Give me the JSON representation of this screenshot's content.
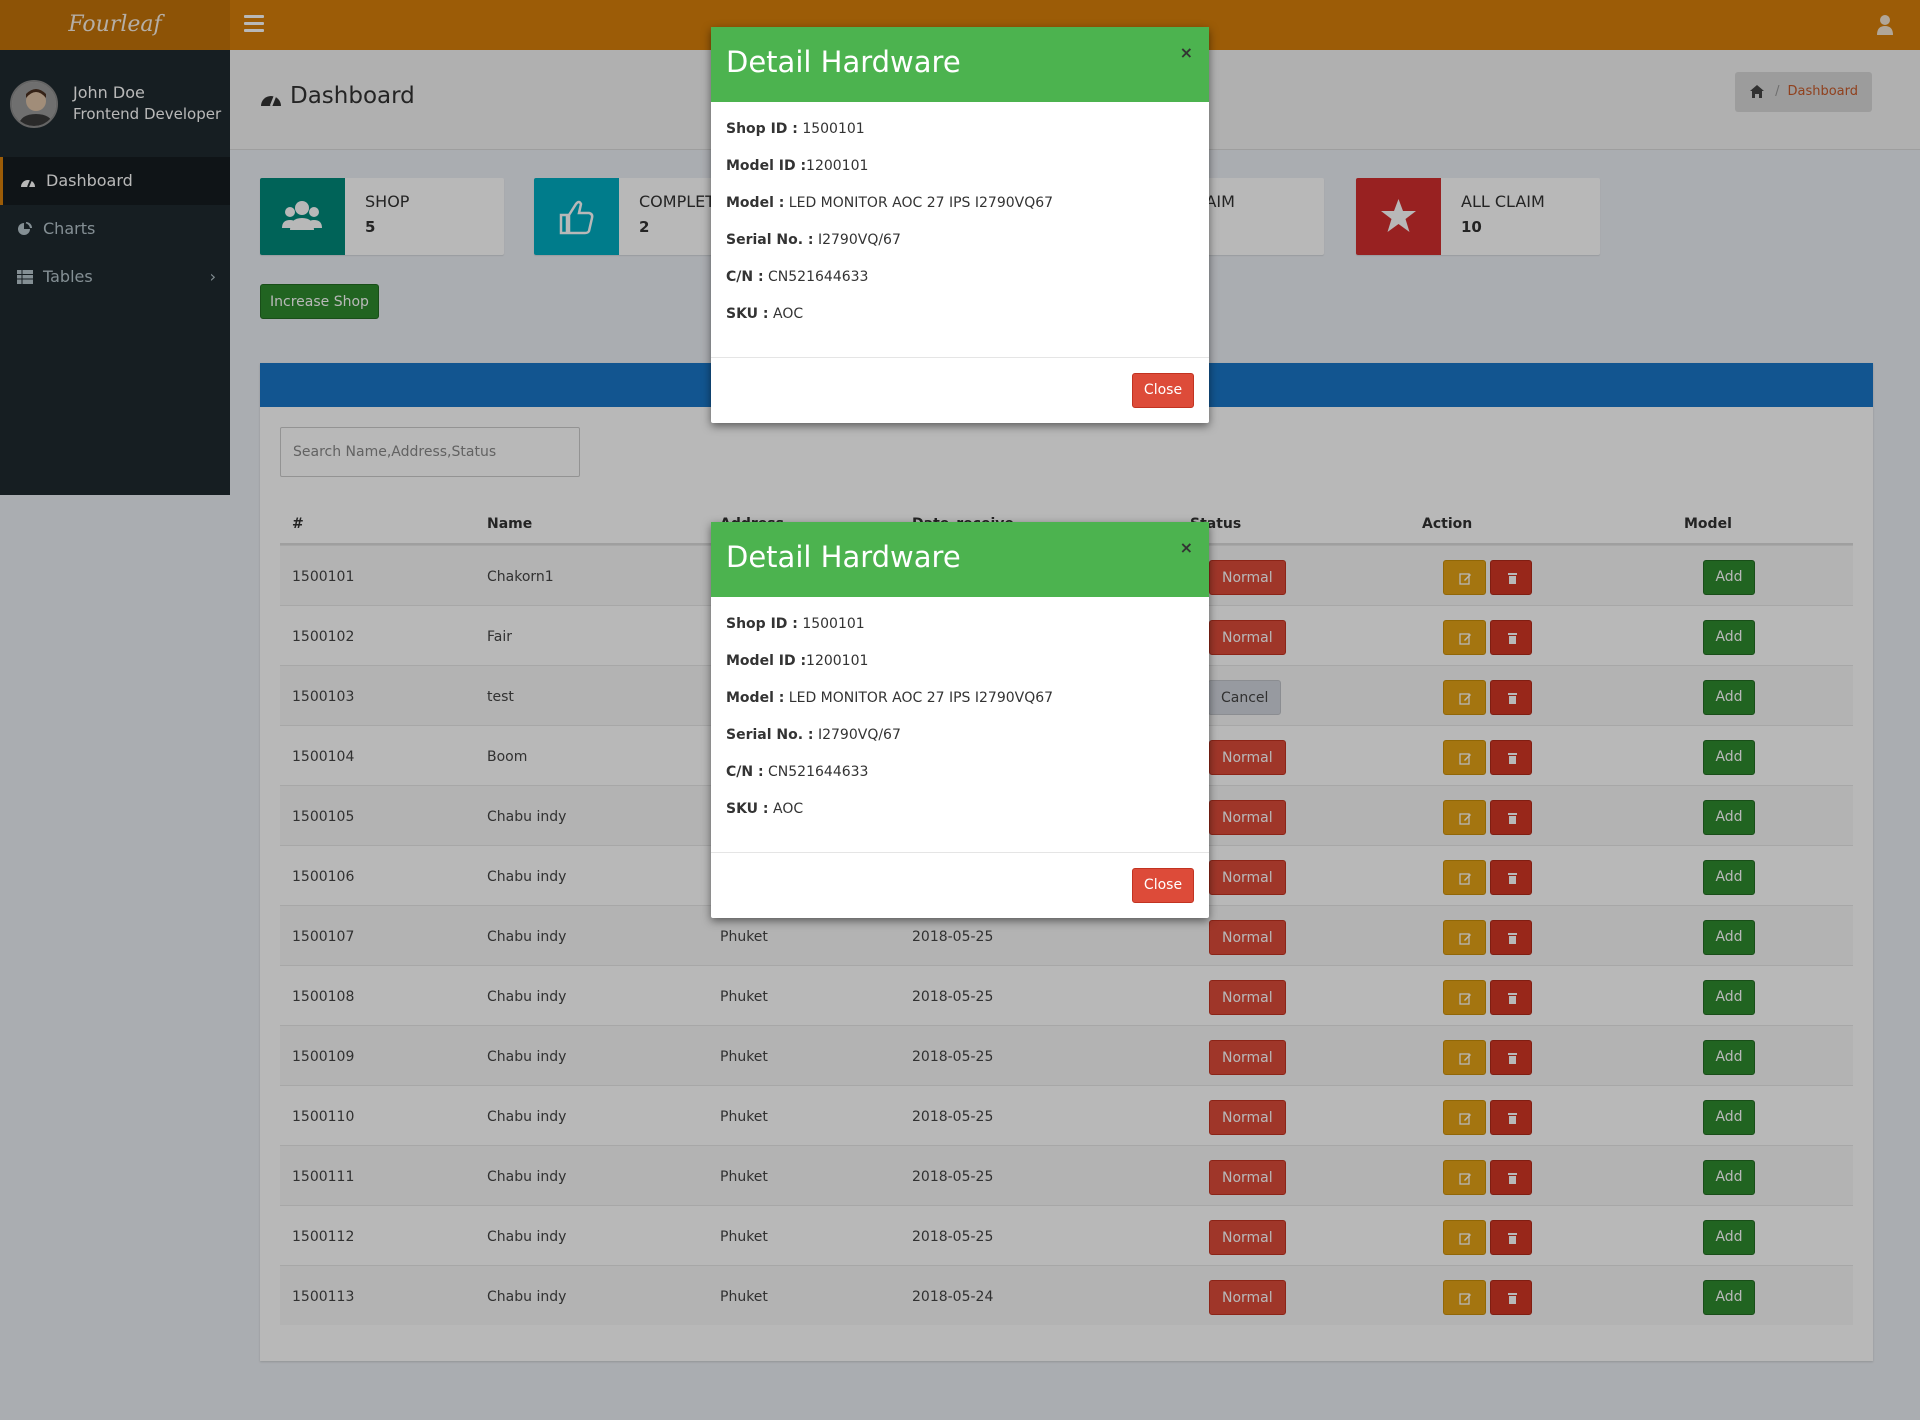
{
  "app": {
    "logo": "Fourleaf"
  },
  "user": {
    "name": "John Doe",
    "role": "Frontend Developer"
  },
  "sidebar": {
    "items": [
      {
        "label": "Dashboard",
        "icon": "dashboard-icon"
      },
      {
        "label": "Charts",
        "icon": "pie-chart-icon"
      },
      {
        "label": "Tables",
        "icon": "table-icon"
      }
    ]
  },
  "header": {
    "title": "Dashboard",
    "breadcrumb": "Dashboard"
  },
  "info_boxes": [
    {
      "label": "SHOP",
      "value": "5",
      "color": "#00897b",
      "icon": "users-icon"
    },
    {
      "label": "COMPLETE",
      "value": "2",
      "color": "#00acc1",
      "icon": "thumbs-up-icon"
    },
    {
      "label": "CLAIM",
      "value": "",
      "color": "#e08e0b",
      "icon": "claim-icon"
    },
    {
      "label": "ALL CLAIM",
      "value": "10",
      "color": "#d32f2f",
      "icon": "star-icon"
    }
  ],
  "actions": {
    "increase_shop": "Increase Shop"
  },
  "search": {
    "placeholder": "Search Name,Address,Status"
  },
  "table": {
    "headers": [
      "#",
      "Name",
      "Address",
      "Date_receive",
      "Status",
      "Action",
      "Model"
    ],
    "rows": [
      {
        "id": "1500101",
        "name": "Chakorn1",
        "address": "",
        "date": "",
        "status": "Normal"
      },
      {
        "id": "1500102",
        "name": "Fair",
        "address": "",
        "date": "",
        "status": "Normal"
      },
      {
        "id": "1500103",
        "name": "test",
        "address": "",
        "date": "",
        "status": "Cancel"
      },
      {
        "id": "1500104",
        "name": "Boom",
        "address": "",
        "date": "",
        "status": "Normal"
      },
      {
        "id": "1500105",
        "name": "Chabu indy",
        "address": "",
        "date": "",
        "status": "Normal"
      },
      {
        "id": "1500106",
        "name": "Chabu indy",
        "address": "",
        "date": "",
        "status": "Normal"
      },
      {
        "id": "1500107",
        "name": "Chabu indy",
        "address": "Phuket",
        "date": "2018-05-25",
        "status": "Normal"
      },
      {
        "id": "1500108",
        "name": "Chabu indy",
        "address": "Phuket",
        "date": "2018-05-25",
        "status": "Normal"
      },
      {
        "id": "1500109",
        "name": "Chabu indy",
        "address": "Phuket",
        "date": "2018-05-25",
        "status": "Normal"
      },
      {
        "id": "1500110",
        "name": "Chabu indy",
        "address": "Phuket",
        "date": "2018-05-25",
        "status": "Normal"
      },
      {
        "id": "1500111",
        "name": "Chabu indy",
        "address": "Phuket",
        "date": "2018-05-25",
        "status": "Normal"
      },
      {
        "id": "1500112",
        "name": "Chabu indy",
        "address": "Phuket",
        "date": "2018-05-25",
        "status": "Normal"
      },
      {
        "id": "1500113",
        "name": "Chabu indy",
        "address": "Phuket",
        "date": "2018-05-24",
        "status": "Normal"
      }
    ],
    "add_label": "Add"
  },
  "modals": [
    {
      "title": "Detail Hardware",
      "fields": [
        {
          "label": "Shop ID :",
          "value": "1500101"
        },
        {
          "label": "Model ID :",
          "value": "1200101"
        },
        {
          "label": "Model :",
          "value": "LED MONITOR AOC 27 IPS I2790VQ67"
        },
        {
          "label": "Serial No. :",
          "value": "I2790VQ/67"
        },
        {
          "label": "C/N :",
          "value": "CN521644633"
        },
        {
          "label": "SKU :",
          "value": "AOC"
        }
      ],
      "close_label": "Close",
      "close_x": "×"
    },
    {
      "title": "Detail Hardware",
      "fields": [
        {
          "label": "Shop ID :",
          "value": "1500101"
        },
        {
          "label": "Model ID :",
          "value": "1200101"
        },
        {
          "label": "Model :",
          "value": "LED MONITOR AOC 27 IPS I2790VQ67"
        },
        {
          "label": "Serial No. :",
          "value": "I2790VQ/67"
        },
        {
          "label": "C/N :",
          "value": "CN521644633"
        },
        {
          "label": "SKU :",
          "value": "AOC"
        }
      ],
      "close_label": "Close",
      "close_x": "×"
    }
  ]
}
